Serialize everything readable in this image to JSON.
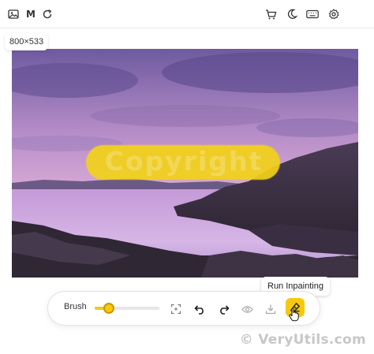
{
  "topbar": {
    "left_icons": [
      "image-icon",
      "mask-letter-icon",
      "refresh-icon"
    ],
    "mask_letter": "M",
    "right_icons": [
      "cart-icon",
      "moon-icon",
      "keyboard-icon",
      "gear-icon"
    ]
  },
  "canvas": {
    "image_size_label": "800×533",
    "watermark_text": "Copyright",
    "mask_color": "#f3d21a"
  },
  "tooltip": {
    "text": "Run Inpainting"
  },
  "toolbar": {
    "brush_label": "Brush",
    "brush_size_fraction": 0.22,
    "accent_color": "#f6c90e",
    "buttons": [
      "reset-zoom-icon",
      "undo-icon",
      "redo-icon",
      "eye-icon",
      "download-icon",
      "eraser-icon"
    ]
  },
  "footer": {
    "watermark": "© VeryUtils.com"
  }
}
